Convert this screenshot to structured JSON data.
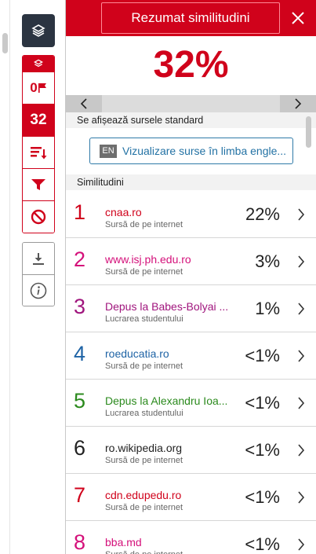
{
  "toolbar": {
    "flag_count": "0",
    "match_count": "32"
  },
  "header": {
    "title": "Rezumat similitudini"
  },
  "summary": {
    "percent": "32%"
  },
  "sources": {
    "standard_label": "Se afișează sursele standard",
    "language_badge": "EN",
    "language_button": "Vizualizare surse în limba engle...",
    "similarity_label": "Similitudini"
  },
  "matches": [
    {
      "rank": "1",
      "name": "cnaa.ro",
      "type": "Sursă de pe internet",
      "percent": "22%",
      "color": "#d0021b"
    },
    {
      "rank": "2",
      "name": "www.isj.ph.edu.ro",
      "type": "Sursă de pe internet",
      "percent": "3%",
      "color": "#d4107a"
    },
    {
      "rank": "3",
      "name": "Depus la Babes-Bolyai ...",
      "type": "Lucrarea studentului",
      "percent": "1%",
      "color": "#a0157d"
    },
    {
      "rank": "4",
      "name": "roeducatia.ro",
      "type": "Sursă de pe internet",
      "percent": "<1%",
      "color": "#1e63a5"
    },
    {
      "rank": "5",
      "name": "Depus la Alexandru Ioa...",
      "type": "Lucrarea studentului",
      "percent": "<1%",
      "color": "#2b8a1d"
    },
    {
      "rank": "6",
      "name": "ro.wikipedia.org",
      "type": "Sursă de pe internet",
      "percent": "<1%",
      "color": "#222222"
    },
    {
      "rank": "7",
      "name": "cdn.edupedu.ro",
      "type": "Sursă de pe internet",
      "percent": "<1%",
      "color": "#d0021b"
    },
    {
      "rank": "8",
      "name": "bba.md",
      "type": "Sursă de pe internet",
      "percent": "<1%",
      "color": "#d4107a"
    }
  ],
  "colors": {
    "accent": "#d0021b",
    "toolbar_dark": "#2b3441",
    "link_blue": "#2372a4"
  }
}
